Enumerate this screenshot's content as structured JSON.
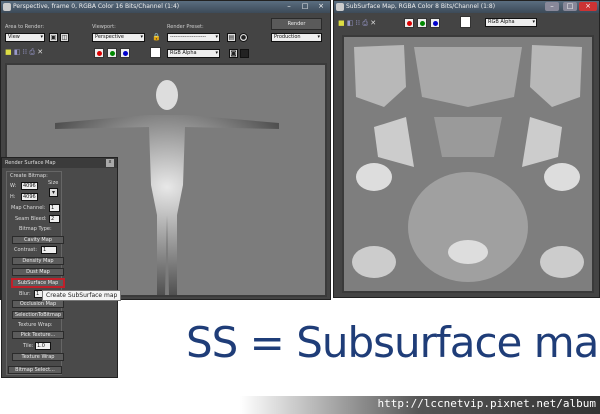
{
  "left_window": {
    "title": "Perspective, frame 0, RGBA Color 16 Bits/Channel (1:4)",
    "area_label": "Area to Render:",
    "area_value": "View",
    "viewport_label": "Viewport:",
    "viewport_value": "Perspective",
    "preset_label": "Render Preset:",
    "preset_value": "--------------------",
    "render_button": "Render",
    "render_mode": "Production",
    "channel_value": "RGB Alpha"
  },
  "right_window": {
    "title": "SubSurface Map, RGBA Color 8 Bits/Channel (1:8)",
    "channel_value": "RGB Alpha"
  },
  "panel": {
    "title": "Render Surface Map",
    "close": "x",
    "create_bitmap": "Create Bitmap:",
    "w_label": "W:",
    "w_value": "4096",
    "h_label": "H:",
    "h_value": "4096",
    "size_label": "Size",
    "map_channel_label": "Map Channel:",
    "map_channel_value": "1",
    "seam_bleed_label": "Seam Bleed:",
    "seam_bleed_value": "2",
    "bitmap_type": "Bitmap Type:",
    "cavity": "Cavity Map",
    "contrast_label": "Contrast:",
    "contrast_value": "1",
    "density": "Density Map",
    "dust": "Dust Map",
    "subsurface": "SubSurface Map",
    "blur_label": "Blur:",
    "blur_value": "1",
    "occlusion": "Occlusion Map",
    "selection": "SelectionToBitmap",
    "texture_wrap_label": "Texture Wrap:",
    "pick_texture": "Pick Texture...",
    "tile_label": "Tile:",
    "tile_value": "1.0",
    "texture_wrap": "Texture Wrap",
    "bitmap_select": "Bitmap Select...",
    "tooltip": "Create SubSurface map"
  },
  "caption": "SS = Subsurface map",
  "watermark": "http://lccnetvip.pixnet.net/album",
  "colors": {
    "caption": "#1f3d78",
    "highlight": "#c0202a"
  }
}
